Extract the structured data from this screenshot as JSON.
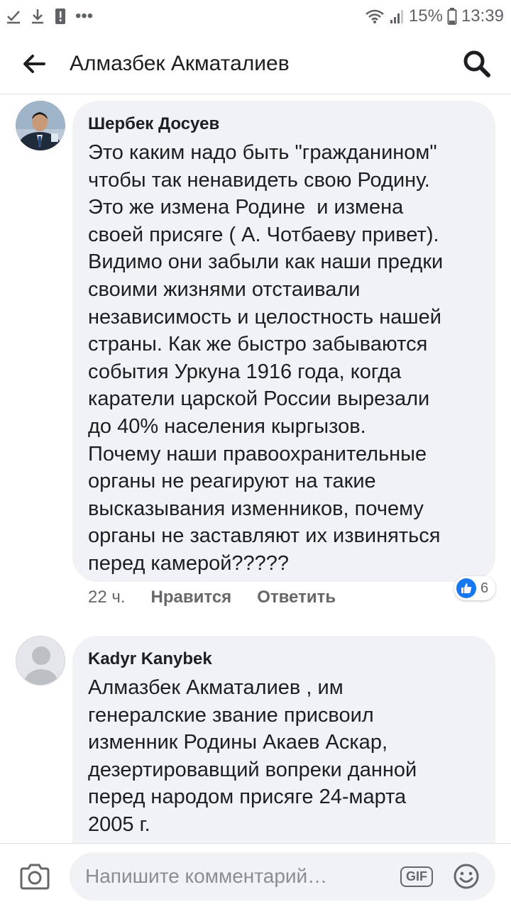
{
  "status_bar": {
    "battery": "15%",
    "time": "13:39"
  },
  "header": {
    "title": "Алмазбек Акматалиев"
  },
  "comments": [
    {
      "author": "Шербек Досуев",
      "text": "Это каким надо быть \"гражданином\"\nчтобы так ненавидеть свою Родину.\nЭто же измена Родине  и измена\nсвоей присяге ( А. Чотбаеву привет).\nВидимо они забыли как наши предки\nсвоими жизнями отстаивали\nнезависимость и целостность нашей\nстраны. Как же быстро забываются\nсобытия Уркуна 1916 года, когда\nкаратели царской России вырезали\nдо 40% населения кыргызов.\nПочему наши правоохранительные\nорганы не реагируют на такие\nвысказывания изменников, почему\nорганы не заставляют их извиняться\nперед камерой?????",
      "time": "22 ч.",
      "like_label": "Нравится",
      "reply_label": "Ответить",
      "reaction_count": "6"
    },
    {
      "author": "Kadyr Kanybek",
      "text": "Алмазбек Акматалиев , им\nгенералские звание присвоил\nизменник Родины Акаев Аскар,\nдезертировавщий вопреки данной\nперед народом присяге 24-марта\n2005 г."
    }
  ],
  "composer": {
    "placeholder": "Напишите комментарий…",
    "gif_label": "GIF"
  },
  "colors": {
    "accent": "#1877f2",
    "bubble": "#f0f2f5",
    "secondary_text": "#65676b"
  }
}
